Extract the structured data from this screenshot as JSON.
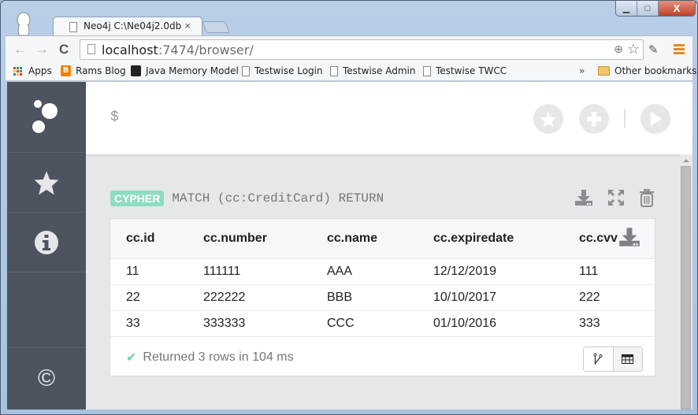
{
  "browser": {
    "tab_title": "Neo4j C:\\Ne04j2.0db",
    "tab_close": "×",
    "url_host": "localhost",
    "url_rest": ":7474/browser/",
    "window_controls": {
      "minimize": "▁",
      "maximize": "□",
      "close": "X"
    },
    "nav": {
      "back": "←",
      "forward": "→",
      "reload": "C"
    }
  },
  "bookmarks": {
    "items": [
      {
        "label": "Apps",
        "icon": "apps-grid-icon"
      },
      {
        "label": "Rams Blog",
        "icon": "blogger-icon"
      },
      {
        "label": "Java Memory Model",
        "icon": "java-icon"
      },
      {
        "label": "Testwise Login",
        "icon": "page-icon"
      },
      {
        "label": "Testwise Admin",
        "icon": "page-icon"
      },
      {
        "label": "Testwise TWCC",
        "icon": "page-icon"
      }
    ],
    "overflow": "»",
    "other": "Other bookmarks"
  },
  "sidebar": {
    "items": [
      "logo",
      "favorites",
      "info",
      "about"
    ],
    "copyright_glyph": "©"
  },
  "editor": {
    "prompt": "$"
  },
  "frame": {
    "badge": "CYPHER",
    "query": "MATCH (cc:CreditCard) RETURN",
    "columns": [
      "cc.id",
      "cc.number",
      "cc.name",
      "cc.expiredate",
      "cc.cvv"
    ],
    "rows": [
      [
        "11",
        "111111",
        "AAA",
        "12/12/2019",
        "111"
      ],
      [
        "22",
        "222222",
        "BBB",
        "10/10/2017",
        "222"
      ],
      [
        "33",
        "333333",
        "CCC",
        "01/10/2016",
        "333"
      ]
    ],
    "status": "Returned 3 rows in 104 ms",
    "colors": {
      "badge": "#8dddc3",
      "check": "#5fd7a0",
      "sidebar": "#4d5460"
    }
  }
}
